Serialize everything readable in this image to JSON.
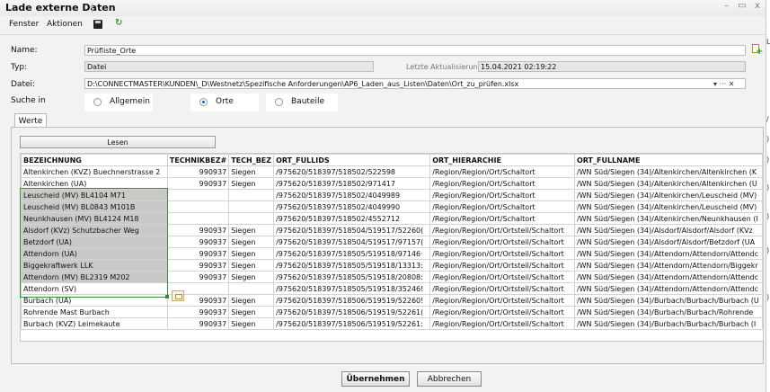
{
  "window": {
    "title": "Lade externe Daten",
    "controls": [
      "–",
      "▭",
      "x"
    ]
  },
  "menu": {
    "items": [
      "Fenster",
      "Aktionen"
    ],
    "save_icon": "save-icon",
    "refresh_icon": "refresh-icon"
  },
  "form": {
    "name_label": "Name:",
    "name_value": "Prüfliste_Orte",
    "typ_label": "Typ:",
    "typ_value": "Datei",
    "updated_label": "Letzte Aktualisierung:",
    "updated_value": "15.04.2021 02:19:22",
    "datei_label": "Datei:",
    "datei_value": "D:\\CONNECTMASTER\\KUNDEN\\_D\\Westnetz\\Spezifische Anforderungen\\AP6_Laden_aus_Listen\\Daten\\Ort_zu_prüfen.xlsx",
    "datei_controls": "▾ ··· ✕",
    "suche_label": "Suche in",
    "radios": [
      {
        "label": "Allgemein",
        "checked": false
      },
      {
        "label": "Orte",
        "checked": true
      },
      {
        "label": "Bauteile",
        "checked": false
      }
    ]
  },
  "tabs": {
    "werte": "Werte"
  },
  "buttons": {
    "lesen": "Lesen",
    "ok": "Übernehmen",
    "cancel": "Abbrechen"
  },
  "table": {
    "columns": [
      "BEZEICHNUNG",
      "TECHNIKBEZ#",
      "TECH_BEZ",
      "ORT_FULLIDS",
      "ORT_HIERARCHIE",
      "ORT_FULLNAME"
    ],
    "rows": [
      [
        "Altenkirchen (KVZ) Buechnerstrasse 2",
        "990937",
        "Siegen",
        "/975620/518397/518502/522598",
        "/Region/Region/Ort/Schaltort",
        "/WN Süd/Siegen (34)/Altenkirchen/Altenkirchen (K"
      ],
      [
        "Altenkirchen (UA)",
        "990937",
        "Siegen",
        "/975620/518397/518502/971417",
        "/Region/Region/Ort/Schaltort",
        "/WN Süd/Siegen (34)/Altenkirchen/Altenkirchen (U"
      ],
      [
        "Leuscheid (MV) BL4104 M71",
        "",
        "",
        "/975620/518397/518502/4049989",
        "/Region/Region/Ort/Schaltort",
        "/WN Süd/Siegen (34)/Altenkirchen/Leuscheid (MV)"
      ],
      [
        "Leuscheid (MV) BL0843 M101B",
        "",
        "",
        "/975620/518397/518502/4049990",
        "/Region/Region/Ort/Schaltort",
        "/WN Süd/Siegen (34)/Altenkirchen/Leuscheid (MV)"
      ],
      [
        "Neunkhausen (MV) BL4124 M18",
        "",
        "",
        "/975620/518397/518502/4552712",
        "/Region/Region/Ort/Schaltort",
        "/WN Süd/Siegen (34)/Altenkirchen/Neunkhausen (I"
      ],
      [
        "Alsdorf (KVz) Schutzbacher Weg",
        "990937",
        "Siegen",
        "/975620/518397/518504/519517/52260(",
        "/Region/Region/Ort/Ortsteil/Schaltort",
        "/WN Süd/Siegen (34)/Alsdorf/Alsdorf/Alsdorf (KVz"
      ],
      [
        "Betzdorf (UA)",
        "990937",
        "Siegen",
        "/975620/518397/518504/519517/97157(",
        "/Region/Region/Ort/Ortsteil/Schaltort",
        "/WN Süd/Siegen (34)/Alsdorf/Alsdorf/Betzdorf (UA"
      ],
      [
        "Attendorn (UA)",
        "990937",
        "Siegen",
        "/975620/518397/518505/519518/97146·",
        "/Region/Region/Ort/Ortsteil/Schaltort",
        "/WN Süd/Siegen (34)/Attendorn/Attendorn/Attendc"
      ],
      [
        "Biggekraftwerk LLK",
        "990937",
        "Siegen",
        "/975620/518397/518505/519518/13313:",
        "/Region/Region/Ort/Ortsteil/Schaltort",
        "/WN Süd/Siegen (34)/Attendorn/Attendorn/Biggekr"
      ],
      [
        "Attendorn (MV) BL2319 M202",
        "990937",
        "Siegen",
        "/975620/518397/518505/519518/20808:",
        "/Region/Region/Ort/Ortsteil/Schaltort",
        "/WN Süd/Siegen (34)/Attendorn/Attendorn/Attendc"
      ],
      [
        "Attendorn (SV)",
        "",
        "",
        "/975620/518397/518505/519518/35246!",
        "/Region/Region/Ort/Ortsteil/Schaltort",
        "/WN Süd/Siegen (34)/Attendorn/Attendorn/Attendc"
      ],
      [
        "Burbach (UA)",
        "990937",
        "Siegen",
        "/975620/518397/518506/519519/52260!",
        "/Region/Region/Ort/Ortsteil/Schaltort",
        "/WN Süd/Siegen (34)/Burbach/Burbach/Burbach (U"
      ],
      [
        "Rohrende Mast Burbach",
        "990937",
        "Siegen",
        "/975620/518397/518506/519519/52261(",
        "/Region/Region/Ort/Ortsteil/Schaltort",
        "/WN Süd/Siegen (34)/Burbach/Burbach/Rohrende"
      ],
      [
        "Burbach (KVZ) Leimekaute",
        "990937",
        "Siegen",
        "/975620/518397/518506/519519/52261:",
        "/Region/Region/Ort/Ortsteil/Schaltort",
        "/WN Süd/Siegen (34)/Burbach/Burbach/Burbach (I"
      ]
    ],
    "selected_rows": [
      2,
      3,
      4,
      5,
      6,
      7,
      8,
      9
    ]
  },
  "edge_glyphs": [
    "L",
    "/",
    ")",
    ")",
    ")",
    ")",
    ")",
    ")"
  ],
  "colors": {
    "selection_border": "#3c8a3c",
    "selected_fill": "#c9c9c9"
  }
}
